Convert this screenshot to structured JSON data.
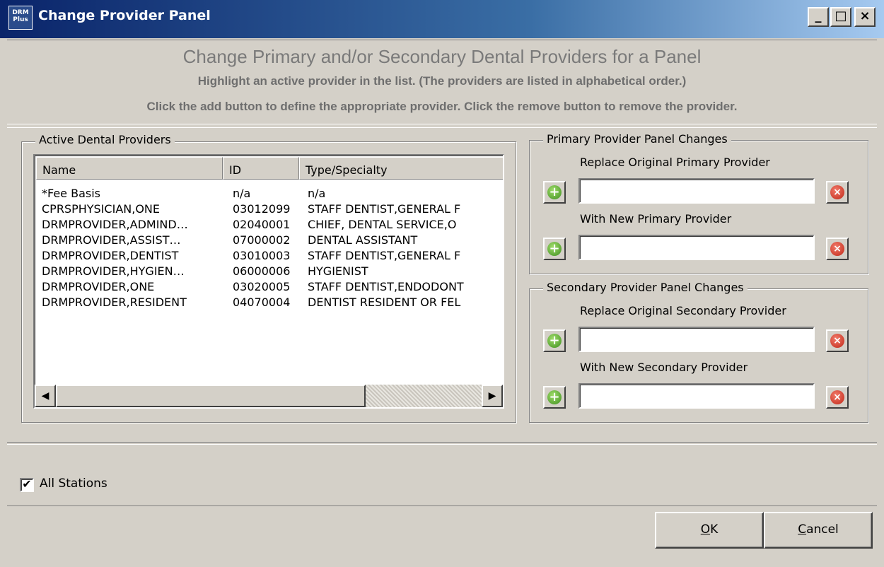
{
  "window": {
    "title": "Change Provider Panel",
    "icon_text_top": "DRM",
    "icon_text_bottom": "Plus",
    "minimize_glyph": "_",
    "maximize_glyph": "□",
    "close_glyph": "×"
  },
  "header": {
    "heading": "Change Primary and/or Secondary Dental Providers for a Panel",
    "instruction_1": "Highlight an active provider in the list.  (The providers are listed in alphabetical order.)",
    "instruction_2": "Click the add button to define the appropriate provider.  Click the remove button to remove the provider."
  },
  "providers": {
    "group_title": "Active Dental Providers",
    "columns": [
      "Name",
      "ID",
      "Type/Specialty"
    ],
    "rows": [
      {
        "name": "*Fee Basis",
        "id": "n/a",
        "type": "n/a"
      },
      {
        "name": "CPRSPHYSICIAN,ONE",
        "id": "03012099",
        "type": "STAFF DENTIST,GENERAL F"
      },
      {
        "name": "DRMPROVIDER,ADMIND…",
        "id": "02040001",
        "type": "CHIEF, DENTAL SERVICE,O"
      },
      {
        "name": "DRMPROVIDER,ASSIST…",
        "id": "07000002",
        "type": "DENTAL ASSISTANT"
      },
      {
        "name": "DRMPROVIDER,DENTIST",
        "id": "03010003",
        "type": "STAFF DENTIST,GENERAL F"
      },
      {
        "name": "DRMPROVIDER,HYGIEN…",
        "id": "06000006",
        "type": "HYGIENIST"
      },
      {
        "name": "DRMPROVIDER,ONE",
        "id": "03020005",
        "type": "STAFF DENTIST,ENDODONT"
      },
      {
        "name": "DRMPROVIDER,RESIDENT",
        "id": "04070004",
        "type": "DENTIST RESIDENT OR FEL"
      }
    ],
    "scroll_left_glyph": "◀",
    "scroll_right_glyph": "▶"
  },
  "primary": {
    "group_title": "Primary Provider Panel Changes",
    "replace_label": "Replace Original Primary Provider",
    "replace_value": "",
    "new_label": "With New Primary Provider",
    "new_value": ""
  },
  "secondary": {
    "group_title": "Secondary Provider Panel Changes",
    "replace_label": "Replace Original Secondary Provider",
    "replace_value": "",
    "new_label": "With New Secondary Provider",
    "new_value": ""
  },
  "buttons": {
    "add_glyph": "+",
    "remove_glyph": "×",
    "ok_mnemonic": "O",
    "ok_rest": "K",
    "cancel_mnemonic": "C",
    "cancel_rest": "ancel"
  },
  "all_stations": {
    "label": "All Stations",
    "checked": true,
    "check_glyph": "✔"
  },
  "colors": {
    "face": "#d4d0c8",
    "title_gradient_start": "#0a246a",
    "title_gradient_end": "#a6caf0",
    "add_green": "#3f8f1f",
    "remove_red": "#c02818"
  }
}
